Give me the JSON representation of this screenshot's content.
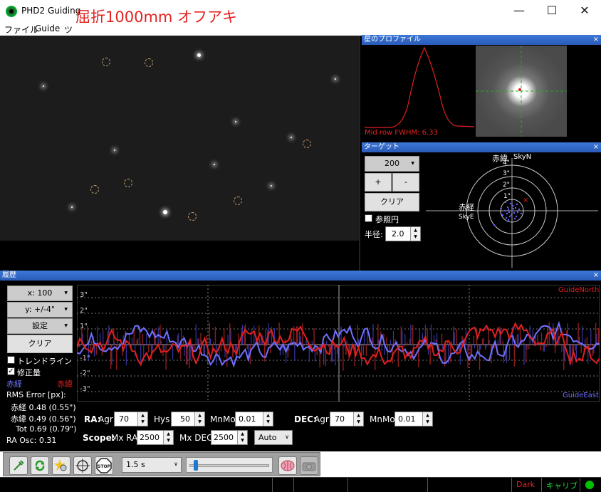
{
  "window": {
    "title": "PHD2 Guiding",
    "overlay_title": "屈折1000mm オフアキ",
    "minimize": "—",
    "maximize": "☐",
    "close": "✕"
  },
  "menu": [
    "ファイル",
    "Guide",
    "ツ"
  ],
  "profile_panel": {
    "title": "星のプロファイル",
    "close": "×",
    "fwhm_label": "Mid row FWHM: 6.33"
  },
  "target_panel": {
    "title": "ターゲット",
    "close": "×",
    "zoom_value": "200",
    "plus": "+",
    "minus": "-",
    "clear": "クリア",
    "reference_circle": "参照円",
    "radius_label": "半径:",
    "radius_value": "2.0",
    "axis_dec": "赤緯",
    "axis_skyn": "SkyN",
    "axis_ra": "赤経",
    "axis_skye": "SkyE",
    "rings": [
      "4\"",
      "3\"",
      "2\"",
      "1\""
    ]
  },
  "history_panel": {
    "title": "履歴",
    "close": "×",
    "x_scale": "x: 100",
    "y_scale": "y: +/-4\"",
    "settings": "設定",
    "clear": "クリア",
    "trendline": "トレンドライン",
    "corrections": "修正量",
    "ra_legend": "赤経",
    "dec_legend": "赤緯",
    "rms_title": "RMS Error [px]:",
    "rms_ra": "赤経 0.48 (0.55\")",
    "rms_dec": "赤緯 0.49 (0.56\")",
    "rms_tot": "Tot 0.69 (0.79\")",
    "ra_osc": "RA Osc: 0.31",
    "y_labels": [
      "3\"",
      "2\"",
      "1\"",
      "-1\"",
      "-2\"",
      "-3\""
    ],
    "guide_north": "GuideNorth",
    "guide_east": "GuideEast"
  },
  "params": {
    "ra_label": "RA:",
    "agr_label": "Agr",
    "ra_agr": "70",
    "hys_label": "Hys",
    "hys": "50",
    "mnmo_label": "MnMo",
    "ra_mnmo": "0.01",
    "dec_label": "DEC:",
    "dec_agr": "70",
    "dec_mnmo": "0.01",
    "scope_label": "Scope:",
    "mxra_label": "Mx RA",
    "mxra": "2500",
    "mxdec_label": "Mx DEC",
    "mxdec": "2500",
    "dec_mode": "Auto"
  },
  "toolbar": {
    "exposure": "1.5 s",
    "stop_label": "STOP"
  },
  "status": {
    "dark": "Dark",
    "calib": "キャリブ",
    "dark_color": "#e02020",
    "calib_color": "#20e040",
    "led_color": "#00c000"
  },
  "colors": {
    "ra": "#7070ff",
    "dec": "#e02020",
    "panel": "#3c78d8"
  }
}
